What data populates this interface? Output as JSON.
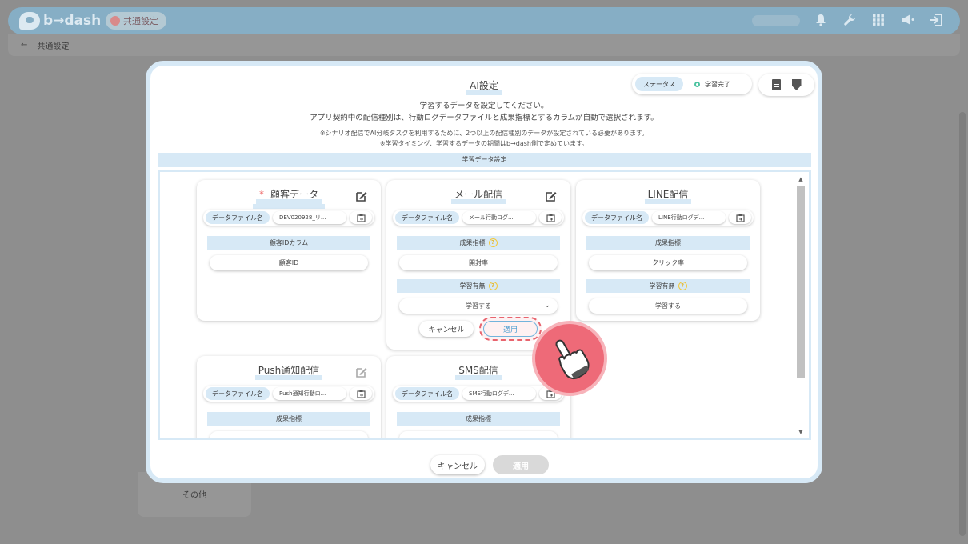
{
  "app": {
    "logo_text": "b→dash",
    "badge": "共通設定",
    "breadcrumb_back": "←",
    "breadcrumb": "共通設定",
    "sidebar_other": "その他",
    "top_icons": [
      "bell-icon",
      "wrench-icon",
      "grid-icon",
      "megaphone-icon",
      "logout-icon"
    ]
  },
  "modal": {
    "title": "AI設定",
    "status_label": "ステータス",
    "status_value": "学習完了",
    "status_color": "#4cc3a0",
    "desc_line1": "学習するデータを設定してください。",
    "desc_line2": "アプリ契約中の配信種別は、行動ログデータファイルと成果指標とするカラムが自動で選択されます。",
    "note_line1": "※シナリオ配信でAI分岐タスクを利用するために、2つ以上の配信種別のデータが設定されている必要があります。",
    "note_line2": "※学習タイミング、学習するデータの期間はb→dash側で定めています。",
    "section_header": "学習データ設定",
    "cancel": "キャンセル",
    "apply": "適用"
  },
  "cards": {
    "customer": {
      "required_mark": "*",
      "title": "顧客データ",
      "file_label": "データファイル名",
      "file_name": "DEV020928_リ...",
      "field1_label": "顧客IDカラム",
      "field1_value": "顧客ID"
    },
    "mail": {
      "title": "メール配信",
      "file_label": "データファイル名",
      "file_name": "メール行動ログ...",
      "field1_label": "成果指標",
      "field1_value": "開封率",
      "field2_label": "学習有無",
      "field2_value": "学習する",
      "cancel": "キャンセル",
      "apply": "適用"
    },
    "line": {
      "title": "LINE配信",
      "file_label": "データファイル名",
      "file_name": "LINE行動ログデ...",
      "field1_label": "成果指標",
      "field1_value": "クリック率",
      "field2_label": "学習有無",
      "field2_value": "学習する"
    },
    "push": {
      "title": "Push通知配信",
      "file_label": "データファイル名",
      "file_name": "Push通知行動ロ...",
      "field1_label": "成果指標"
    },
    "sms": {
      "title": "SMS配信",
      "file_label": "データファイル名",
      "file_name": "SMS行動ログデ...",
      "field1_label": "成果指標"
    }
  }
}
